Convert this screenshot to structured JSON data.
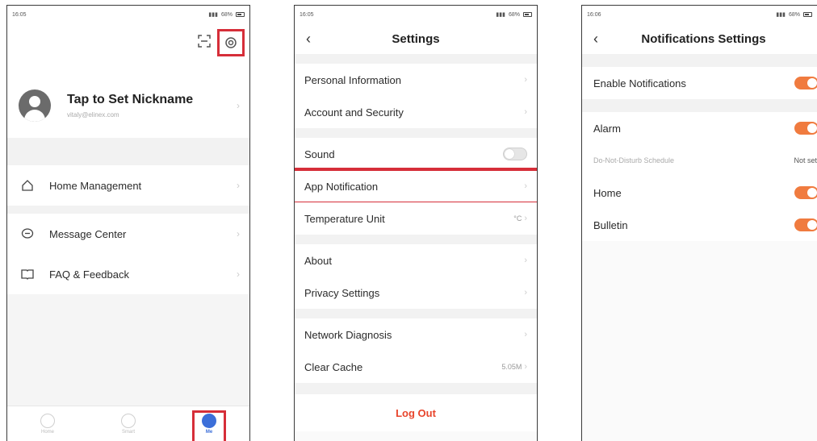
{
  "status": {
    "time_1": "16:05",
    "time_2": "16:05",
    "time_3": "16:06",
    "battery_1": "68%",
    "battery_2": "68%",
    "battery_3": "68%"
  },
  "me_screen": {
    "nickname": "Tap to Set Nickname",
    "email": "vitaly@elinex.com",
    "menu": [
      {
        "label": "Home Management"
      },
      {
        "label": "Message Center"
      },
      {
        "label": "FAQ & Feedback"
      }
    ],
    "tabs": [
      {
        "label": "Home"
      },
      {
        "label": "Smart"
      },
      {
        "label": "Me"
      }
    ]
  },
  "settings_screen": {
    "title": "Settings",
    "personal_info": "Personal Information",
    "account_security": "Account and Security",
    "sound": "Sound",
    "sound_enabled": false,
    "app_notification": "App Notification",
    "temperature_unit": "Temperature Unit",
    "temperature_value": "°C",
    "about": "About",
    "privacy": "Privacy Settings",
    "network": "Network Diagnosis",
    "clear_cache": "Clear Cache",
    "cache_size": "5.05M",
    "logout": "Log Out"
  },
  "notifications_screen": {
    "title": "Notifications Settings",
    "enable": "Enable Notifications",
    "alarm": "Alarm",
    "dnd": "Do-Not-Disturb Schedule",
    "dnd_value": "Not set",
    "home": "Home",
    "bulletin": "Bulletin"
  },
  "colors": {
    "accent": "#f07b3f",
    "highlight": "#d62e39",
    "logout": "#e8452c",
    "me_tab": "#3c6fd9"
  }
}
